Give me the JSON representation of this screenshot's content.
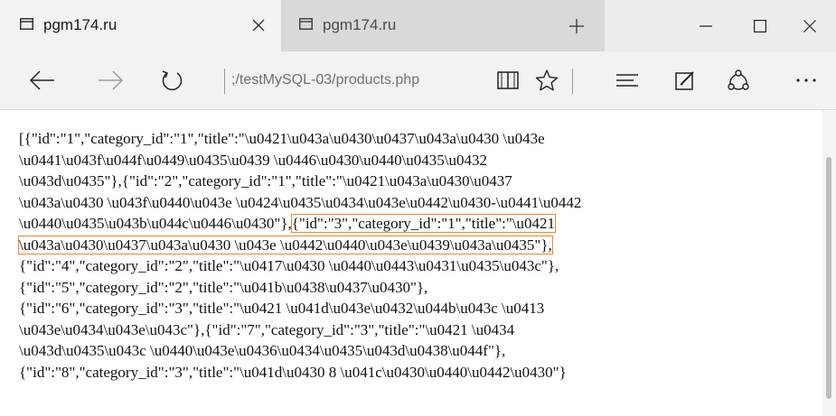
{
  "tabs": [
    {
      "title": "pgm174.ru",
      "active": true
    },
    {
      "title": "pgm174.ru",
      "active": false
    }
  ],
  "window_controls": [
    "minimize-icon",
    "maximize-icon",
    "close-icon"
  ],
  "navbar": {
    "address": ";/testMySQL-03/products.php"
  },
  "content": {
    "lines": [
      [
        "[{\"id\":\"1\",\"category_id\":\"1\",\"title\":\"\\u0421\\u043a\\u0430\\u0437\\u043a\\u0430 \\u043e"
      ],
      [
        "\\u0441\\u043f\\u044f\\u0449\\u0435\\u0439 \\u0446\\u0430\\u0440\\u0435\\u0432"
      ],
      [
        "\\u043d\\u0435\"},{\"id\":\"2\",\"category_id\":\"1\",\"title\":\"\\u0421\\u043a\\u0430\\u0437"
      ],
      [
        "\\u043a\\u0430 \\u043f\\u0440\\u043e \\u0424\\u0435\\u0434\\u043e\\u0442\\u0430-\\u0441\\u0442"
      ],
      [
        "\\u0440\\u0435\\u043b\\u044c\\u0446\\u0430\"},",
        "{\"id\":\"3\",\"category_id\":\"1\",\"title\":\"\\u0421"
      ],
      [
        "\\u043a\\u0430\\u0437\\u043a\\u0430 \\u043e \\u0442\\u0440\\u043e\\u0439\\u043a\\u0435\"},"
      ],
      [
        "{\"id\":\"4\",\"category_id\":\"2\",\"title\":\"\\u0417\\u0430 \\u0440\\u0443\\u0431\\u0435\\u043c\"},"
      ],
      [
        "{\"id\":\"5\",\"category_id\":\"2\",\"title\":\"\\u041b\\u0438\\u0437\\u0430\"},"
      ],
      [
        "{\"id\":\"6\",\"category_id\":\"3\",\"title\":\"\\u0421 \\u041d\\u043e\\u0432\\u044b\\u043c \\u0413"
      ],
      [
        "\\u043e\\u0434\\u043e\\u043c\"},{\"id\":\"7\",\"category_id\":\"3\",\"title\":\"\\u0421 \\u0434"
      ],
      [
        "\\u043d\\u0435\\u043c \\u0440\\u043e\\u0436\\u0434\\u0435\\u043d\\u0438\\u044f\"},"
      ],
      [
        "{\"id\":\"8\",\"category_id\":\"3\",\"title\":\"\\u041d\\u0430 8 \\u041c\\u0430\\u0440\\u0442\\u0430\"}"
      ]
    ]
  }
}
